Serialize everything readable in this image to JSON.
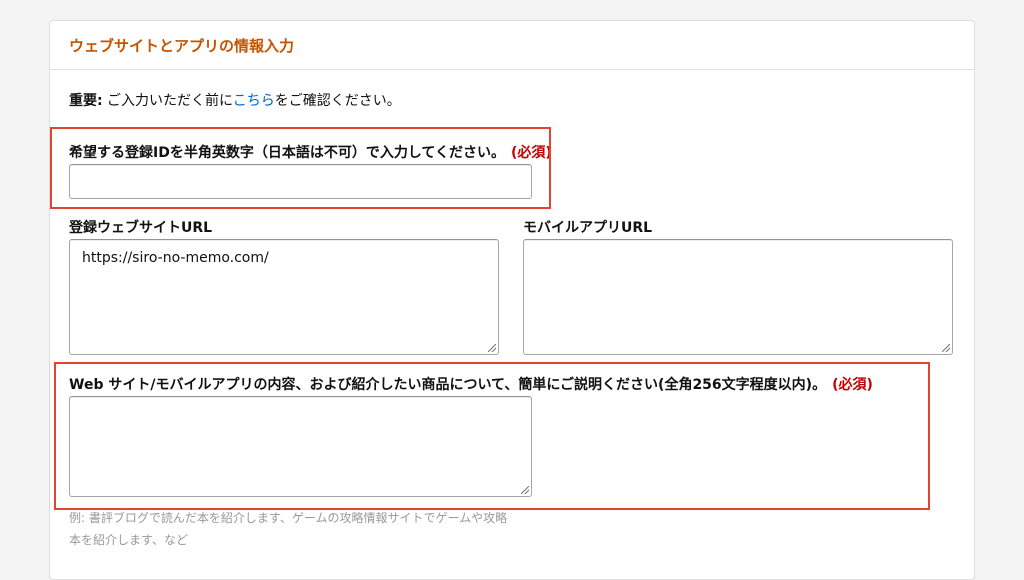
{
  "section": {
    "title": "ウェブサイトとアプリの情報入力"
  },
  "notice": {
    "bold": "重要:",
    "before_link": " ご入力いただく前に",
    "link": "こちら",
    "after_link": "をご確認ください。"
  },
  "login_id": {
    "label": "希望する登録IDを半角英数字（日本語は不可）で入力してください。",
    "required": "(必須)",
    "value": ""
  },
  "website_url": {
    "label": "登録ウェブサイトURL",
    "value": "https://siro-no-memo.com/"
  },
  "app_url": {
    "label": "モバイルアプリURL",
    "value": ""
  },
  "description": {
    "label": "Web サイト/モバイルアプリの内容、および紹介したい商品について、簡単にご説明ください(全角256文字程度以内)。",
    "required": "(必須)",
    "value": "",
    "hint": "例: 書評ブログで読んだ本を紹介します、ゲームの攻略情報サイトでゲームや攻略本を紹介します、など"
  },
  "colors": {
    "title_orange": "#c45500",
    "link_blue": "#0066c0",
    "required_red": "#c40000",
    "annotation_red": "#e0462f"
  }
}
